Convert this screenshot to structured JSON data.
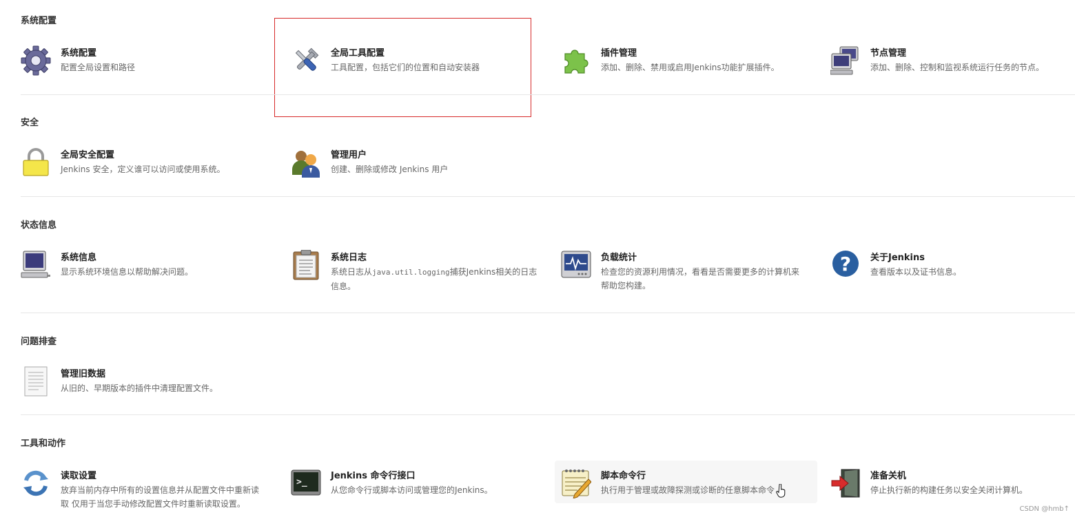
{
  "sections": {
    "system_config": {
      "title": "系统配置",
      "items": [
        {
          "title": "系统配置",
          "desc": "配置全局设置和路径",
          "icon": "gear-icon"
        },
        {
          "title": "全局工具配置",
          "desc": "工具配置，包括它们的位置和自动安装器",
          "icon": "tools-icon"
        },
        {
          "title": "插件管理",
          "desc": "添加、删除、禁用或启用Jenkins功能扩展插件。",
          "icon": "puzzle-icon"
        },
        {
          "title": "节点管理",
          "desc": "添加、删除、控制和监视系统运行任务的节点。",
          "icon": "computers-icon"
        }
      ]
    },
    "security": {
      "title": "安全",
      "items": [
        {
          "title": "全局安全配置",
          "desc": "Jenkins 安全，定义谁可以访问或使用系统。",
          "icon": "lock-icon"
        },
        {
          "title": "管理用户",
          "desc": "创建、删除或修改 Jenkins 用户",
          "icon": "users-icon"
        }
      ]
    },
    "status": {
      "title": "状态信息",
      "items": [
        {
          "title": "系统信息",
          "desc": "显示系统环境信息以帮助解决问题。",
          "icon": "computer-icon"
        },
        {
          "title": "系统日志",
          "desc_pre": "系统日志从",
          "desc_code": "java.util.logging",
          "desc_post": "捕获Jenkins相关的日志",
          "desc_line2": "信息。",
          "icon": "clipboard-icon"
        },
        {
          "title": "负载统计",
          "desc": "检查您的资源利用情况，看看是否需要更多的计算机来",
          "desc_line2": "帮助您构建。",
          "icon": "monitor-icon"
        },
        {
          "title": "关于Jenkins",
          "desc": "查看版本以及证书信息。",
          "icon": "help-icon"
        }
      ]
    },
    "troubleshoot": {
      "title": "问题排查",
      "items": [
        {
          "title": "管理旧数据",
          "desc": "从旧的、早期版本的插件中清理配置文件。",
          "icon": "document-icon"
        }
      ]
    },
    "tools": {
      "title": "工具和动作",
      "items": [
        {
          "title": "读取设置",
          "desc": "放弃当前内存中所有的设置信息并从配置文件中重新读",
          "desc_line2": "取 仅用于当您手动修改配置文件时重新读取设置。",
          "icon": "refresh-icon"
        },
        {
          "title": "Jenkins 命令行接口",
          "desc": "从您命令行或脚本访问或管理您的Jenkins。",
          "icon": "terminal-icon"
        },
        {
          "title": "脚本命令行",
          "desc": "执行用于管理或故障探测或诊断的任意脚本命令",
          "icon": "notepad-icon"
        },
        {
          "title": "准备关机",
          "desc": "停止执行新的构建任务以安全关闭计算机。",
          "icon": "exit-door-icon"
        }
      ]
    }
  },
  "watermark": "CSDN @hmb↑",
  "colors": {
    "highlight": "#d62828",
    "hover": "#f6f6f6"
  }
}
